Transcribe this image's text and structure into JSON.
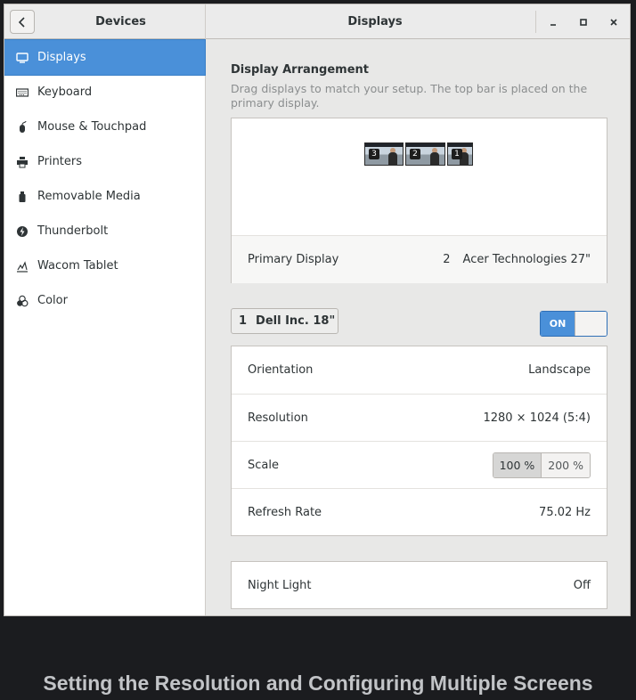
{
  "titlebar": {
    "left_title": "Devices",
    "right_title": "Displays",
    "minimize_icon": "minimize-icon",
    "maximize_icon": "maximize-icon",
    "close_icon": "close-icon"
  },
  "sidebar": {
    "items": [
      {
        "label": "Displays",
        "icon": "display-icon",
        "active": true
      },
      {
        "label": "Keyboard",
        "icon": "keyboard-icon"
      },
      {
        "label": "Mouse & Touchpad",
        "icon": "mouse-icon"
      },
      {
        "label": "Printers",
        "icon": "printer-icon"
      },
      {
        "label": "Removable Media",
        "icon": "usb-icon"
      },
      {
        "label": "Thunderbolt",
        "icon": "thunderbolt-icon"
      },
      {
        "label": "Wacom Tablet",
        "icon": "tablet-icon"
      },
      {
        "label": "Color",
        "icon": "color-icon"
      }
    ]
  },
  "arrangement": {
    "title": "Display Arrangement",
    "subtitle": "Drag displays to match your setup. The top bar is placed on the primary display.",
    "monitors": [
      {
        "number": "3"
      },
      {
        "number": "2"
      },
      {
        "number": "1"
      }
    ],
    "primary_label": "Primary Display",
    "primary_number": "2",
    "primary_name": "Acer Technologies 27\""
  },
  "monitor_selector": {
    "number": "1",
    "name": "Dell Inc. 18\""
  },
  "toggle": {
    "label": "ON",
    "state": true
  },
  "settings": {
    "orientation_label": "Orientation",
    "orientation_value": "Landscape",
    "resolution_label": "Resolution",
    "resolution_value": "1280 × 1024 (5:4)",
    "scale_label": "Scale",
    "scale_options": [
      "100 %",
      "200 %"
    ],
    "scale_selected": "100 %",
    "refresh_label": "Refresh Rate",
    "refresh_value": "75.02 Hz"
  },
  "night_light": {
    "label": "Night Light",
    "value": "Off"
  },
  "caption": "Setting the Resolution and Configuring Multiple Screens",
  "colors": {
    "accent": "#4a90d9",
    "background": "#1b1c1f"
  }
}
